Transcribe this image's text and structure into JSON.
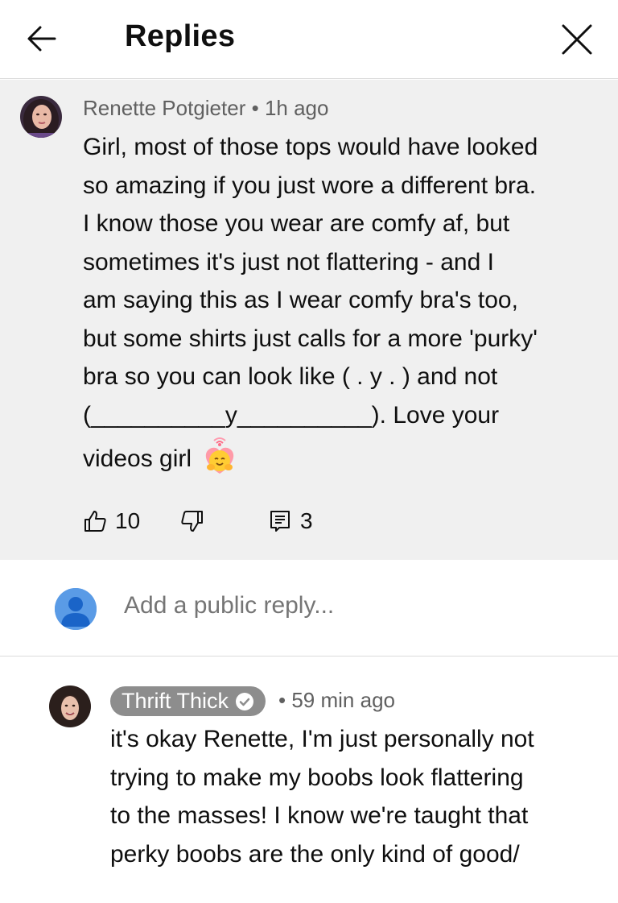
{
  "header": {
    "title": "Replies",
    "back_icon": "arrow-left-icon",
    "close_icon": "close-icon"
  },
  "parent_comment": {
    "author": "Renette Potgieter",
    "time": "1h ago",
    "separator": "•",
    "lines": [
      "Girl, most of those tops would have looked",
      "so amazing if you just wore a different bra.",
      "I know those you wear are comfy af, but",
      "sometimes it's just not flattering - and I",
      "am saying this as I wear comfy bra's too,",
      "but some shirts just calls for a more 'purky'",
      "bra so you can look like ( . y . ) and not",
      "(__________y__________). Love your",
      "videos girl"
    ],
    "emoji_icon": "smiling-face-with-hearts-emoji",
    "likes": "10",
    "replies": "3",
    "like_icon": "thumbs-up-icon",
    "dislike_icon": "thumbs-down-icon",
    "reply_icon": "reply-comment-icon"
  },
  "add_reply": {
    "placeholder": "Add a public reply..."
  },
  "reply": {
    "author": "Thrift Thick",
    "verified_icon": "verified-check-icon",
    "separator": "•",
    "time": "59 min ago",
    "lines": [
      "it's okay Renette, I'm just personally not",
      "trying to make my boobs look flattering",
      "to the masses! I know we're taught that",
      "perky boobs are the only kind of good/"
    ]
  },
  "colors": {
    "background": "#ffffff",
    "comment_background": "#f0f0f0",
    "secondary_text": "#606060",
    "author_badge": "#8d8d8d",
    "default_avatar": "#5a9be6"
  }
}
